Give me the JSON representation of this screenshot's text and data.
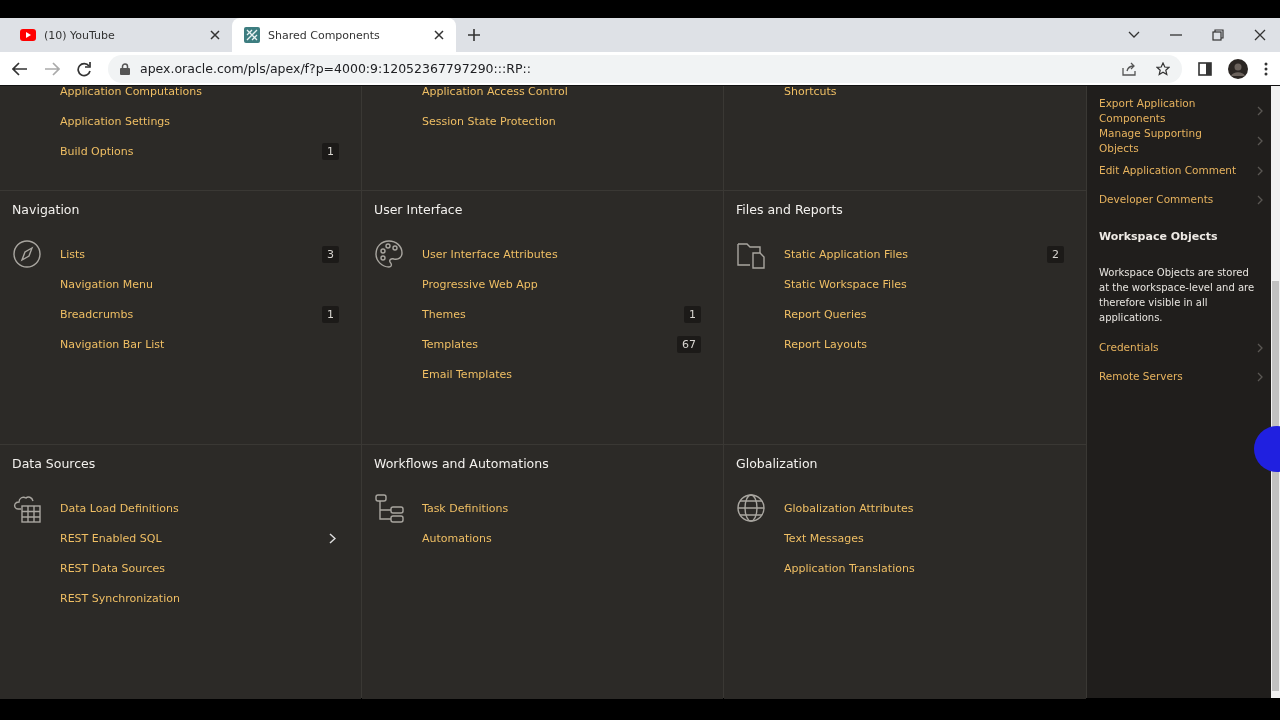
{
  "browser": {
    "tabs": [
      {
        "title": "(10) YouTube",
        "kind": "youtube",
        "selected": false
      },
      {
        "title": "Shared Components",
        "kind": "apex",
        "selected": true
      }
    ],
    "url": "apex.oracle.com/pls/apex/f?p=4000:9:12052367797290:::RP::"
  },
  "top_columns": [
    {
      "items": [
        {
          "label": "Application Computations",
          "hovered": false
        },
        {
          "label": "Application Settings",
          "hovered": false
        },
        {
          "label": "Build Options",
          "count": "1",
          "hovered": false
        }
      ]
    },
    {
      "items": [
        {
          "label": "Application Access Control",
          "hovered": false
        },
        {
          "label": "Session State Protection",
          "hovered": false
        }
      ]
    },
    {
      "items": [
        {
          "label": "Shortcuts",
          "hovered": false
        }
      ]
    }
  ],
  "sections": [
    {
      "title": "Navigation",
      "kind": "compass",
      "items": [
        {
          "label": "Lists",
          "count": "3",
          "hovered": false
        },
        {
          "label": "Navigation Menu",
          "hovered": false
        },
        {
          "label": "Breadcrumbs",
          "count": "1",
          "hovered": false
        },
        {
          "label": "Navigation Bar List",
          "hovered": false
        }
      ]
    },
    {
      "title": "User Interface",
      "kind": "palette",
      "items": [
        {
          "label": "User Interface Attributes",
          "hovered": false
        },
        {
          "label": "Progressive Web App",
          "hovered": false
        },
        {
          "label": "Themes",
          "count": "1",
          "hovered": false
        },
        {
          "label": "Templates",
          "count": "67",
          "hovered": false
        },
        {
          "label": "Email Templates",
          "hovered": false
        }
      ]
    },
    {
      "title": "Files and Reports",
      "kind": "files",
      "items": [
        {
          "label": "Static Application Files",
          "count": "2",
          "hovered": false
        },
        {
          "label": "Static Workspace Files",
          "hovered": false
        },
        {
          "label": "Report Queries",
          "hovered": false
        },
        {
          "label": "Report Layouts",
          "hovered": false
        }
      ]
    },
    {
      "title": "Data Sources",
      "kind": "cloud-grid",
      "items": [
        {
          "label": "Data Load Definitions",
          "hovered": false
        },
        {
          "label": "REST Enabled SQL",
          "hovered": true
        },
        {
          "label": "REST Data Sources",
          "hovered": false
        },
        {
          "label": "REST Synchronization",
          "hovered": false
        }
      ]
    },
    {
      "title": "Workflows and Automations",
      "kind": "tree",
      "items": [
        {
          "label": "Task Definitions",
          "hovered": false
        },
        {
          "label": "Automations",
          "hovered": false
        }
      ]
    },
    {
      "title": "Globalization",
      "kind": "globe",
      "items": [
        {
          "label": "Globalization Attributes",
          "hovered": false
        },
        {
          "label": "Text Messages",
          "hovered": false
        },
        {
          "label": "Application Translations",
          "hovered": false
        }
      ]
    }
  ],
  "sidebar": {
    "links": [
      {
        "label": "Export Application Components"
      },
      {
        "label": "Manage Supporting Objects"
      },
      {
        "label": "Edit Application Comment"
      },
      {
        "label": "Developer Comments"
      }
    ],
    "workspace": {
      "title": "Workspace Objects",
      "description": "Workspace Objects are stored at the workspace-level and are therefore visible in all applications.",
      "links": [
        {
          "label": "Credentials"
        },
        {
          "label": "Remote Servers"
        }
      ]
    }
  }
}
